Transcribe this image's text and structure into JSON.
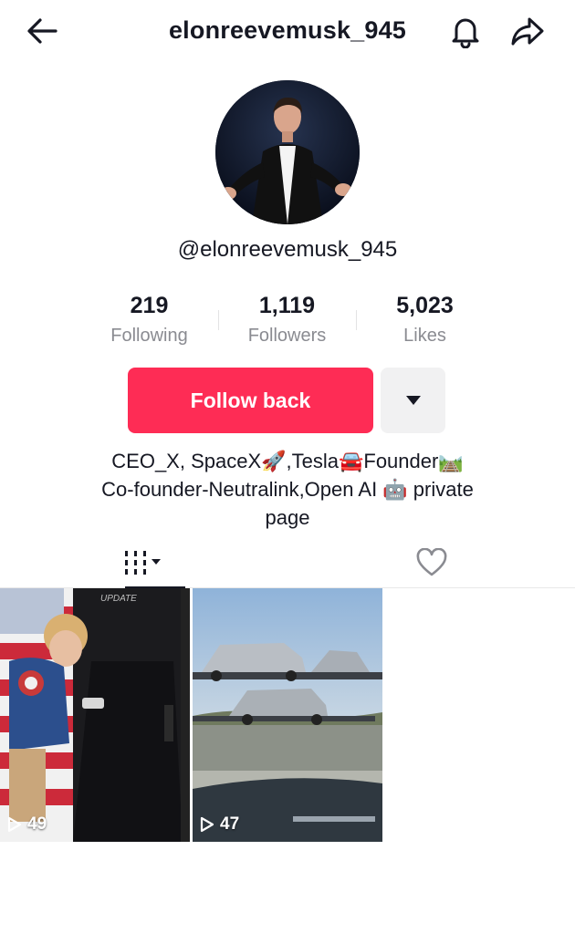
{
  "header": {
    "title": "elonreevemusk_945",
    "back_icon": "arrow-left-icon",
    "bell_icon": "bell-icon",
    "share_icon": "share-arrow-icon"
  },
  "profile": {
    "handle": "@elonreevemusk_945",
    "stats": [
      {
        "value": "219",
        "label": "Following"
      },
      {
        "value": "1,119",
        "label": "Followers"
      },
      {
        "value": "5,023",
        "label": "Likes"
      }
    ],
    "follow_button": "Follow back",
    "more_icon": "caret-down-icon",
    "bio_line1": "CEO_X, SpaceX🚀,Tesla🚘Founder🛤️",
    "bio_line2": "Co-founder-Neutralink,Open AI 🤖  private",
    "bio_line3": "page"
  },
  "tabs": [
    {
      "name": "videos",
      "icon": "grid-icon",
      "selected": true
    },
    {
      "name": "liked",
      "icon": "heart-outline-icon",
      "selected": false
    }
  ],
  "videos": [
    {
      "views": "49",
      "overlay_text": "UPDATE"
    },
    {
      "views": "47"
    }
  ],
  "colors": {
    "accent": "#fe2c55",
    "text": "#161823",
    "muted": "#8a8b91",
    "secondary_button": "#f1f1f2"
  }
}
